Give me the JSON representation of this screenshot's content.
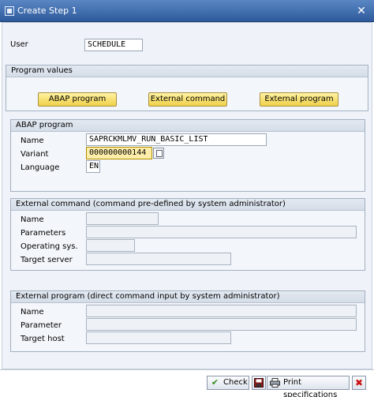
{
  "window": {
    "title": "Create Step  1",
    "close_glyph": "✕"
  },
  "user": {
    "label": "User",
    "value": "SCHEDULE"
  },
  "program_values": {
    "title": "Program values",
    "buttons": {
      "abap": "ABAP program",
      "external_command": "External command",
      "external_program": "External program"
    }
  },
  "abap_program": {
    "title": "ABAP program",
    "name_label": "Name",
    "name_value": "SAPRCKMLMV_RUN_BASIC_LIST",
    "variant_label": "Variant",
    "variant_value": "000000000144",
    "language_label": "Language",
    "language_value": "EN"
  },
  "external_command": {
    "title": "External command (command pre-defined by system administrator)",
    "name_label": "Name",
    "parameters_label": "Parameters",
    "os_label": "Operating sys.",
    "target_label": "Target server"
  },
  "external_program": {
    "title": "External program (direct command input by system administrator)",
    "name_label": "Name",
    "parameter_label": "Parameter",
    "target_label": "Target host"
  },
  "footer": {
    "check_label": "Check",
    "print_label": "Print specifications"
  },
  "colors": {
    "check_icon": "#2e8b1a",
    "cancel_icon": "#cc1010",
    "highlight": "#ffeeaa"
  }
}
